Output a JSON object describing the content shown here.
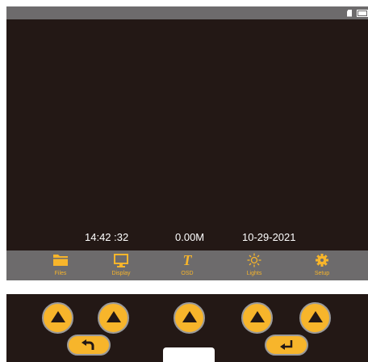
{
  "status": {
    "icons": [
      "sd-card-icon",
      "battery-icon"
    ]
  },
  "readout": {
    "time": "14:42 :32",
    "depth": "0.00M",
    "date": "10-29-2021"
  },
  "menu": {
    "items": [
      {
        "label": "Files",
        "icon": "folder-icon"
      },
      {
        "label": "Display",
        "icon": "monitor-icon"
      },
      {
        "label": "OSD",
        "icon": "text-icon",
        "glyph": "T"
      },
      {
        "label": "Lights",
        "icon": "sun-icon"
      },
      {
        "label": "Setup",
        "icon": "gear-icon"
      }
    ]
  },
  "controls": {
    "round_buttons": [
      "up-arrow-icon",
      "up-arrow-icon",
      "up-arrow-icon",
      "up-arrow-icon",
      "up-arrow-icon"
    ],
    "back_button": "back-arrow-icon",
    "enter_button": "enter-icon"
  },
  "colors": {
    "accent": "#f7b52b",
    "bar": "#6d6b6c",
    "screen": "#231815",
    "text": "#ffffff"
  }
}
